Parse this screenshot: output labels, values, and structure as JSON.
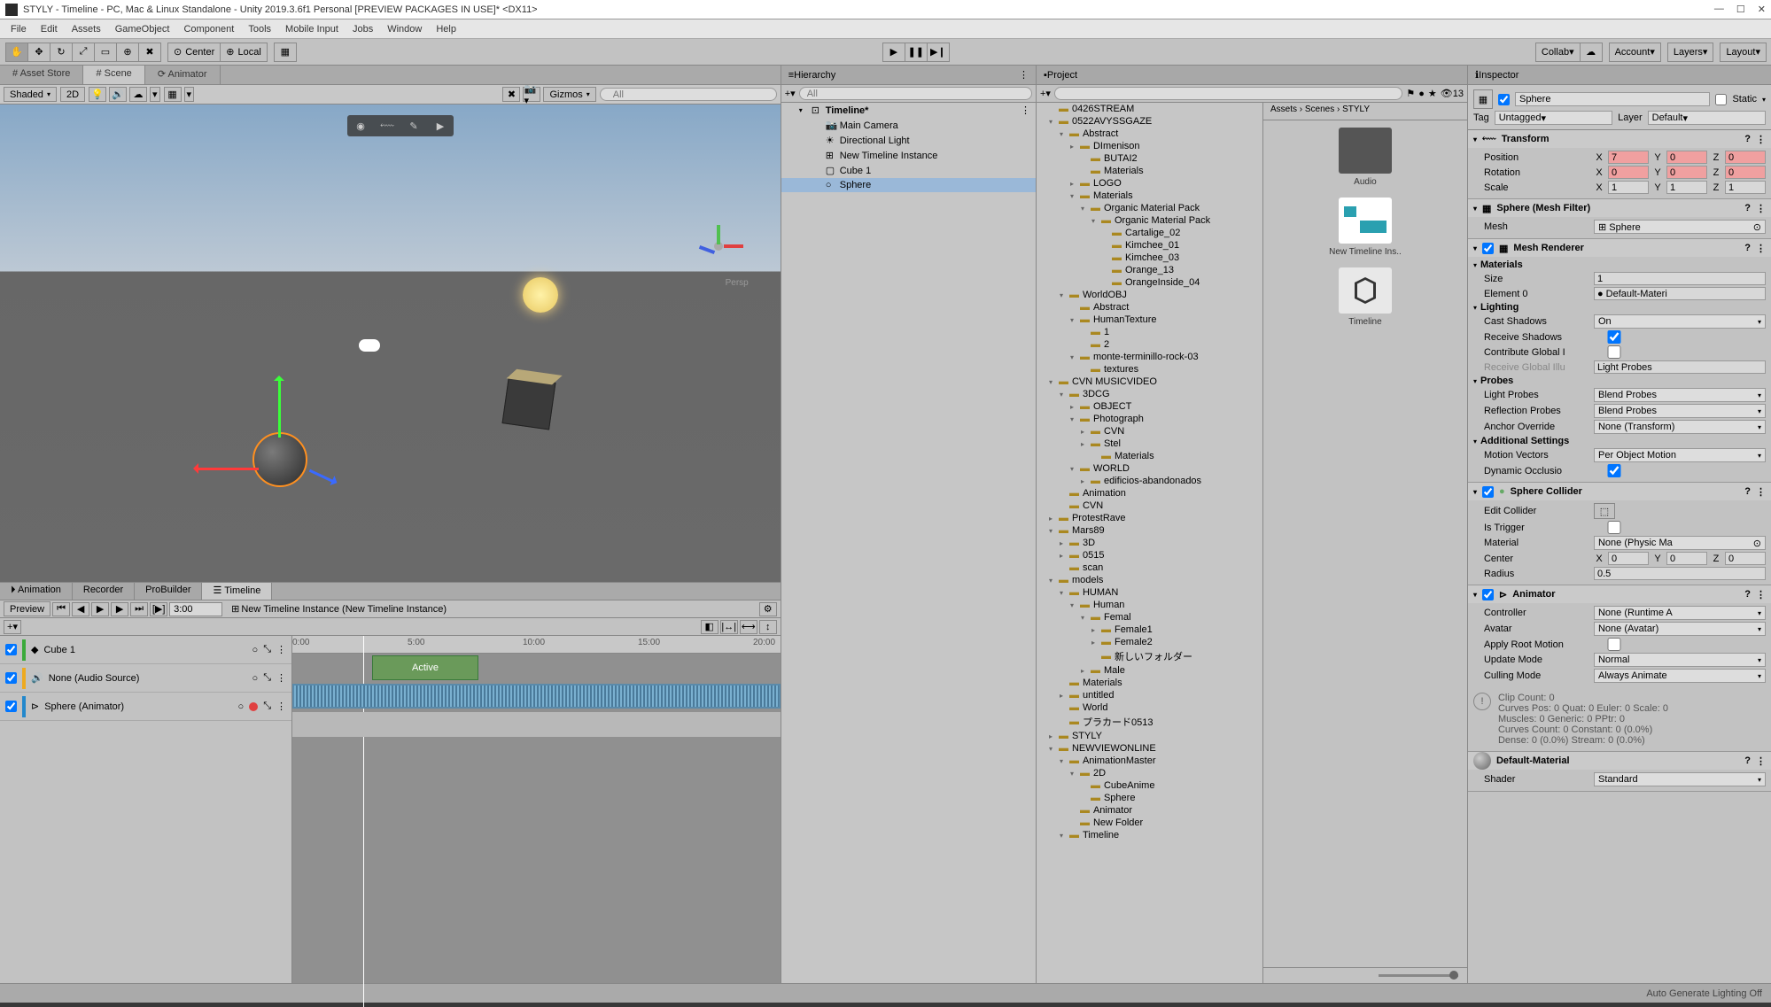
{
  "title": "STYLY - Timeline - PC, Mac & Linux Standalone - Unity 2019.3.6f1 Personal [PREVIEW PACKAGES IN USE]* <DX11>",
  "menu": [
    "File",
    "Edit",
    "Assets",
    "GameObject",
    "Component",
    "Tools",
    "Mobile Input",
    "Jobs",
    "Window",
    "Help"
  ],
  "windowControls": [
    "—",
    "☐",
    "✕"
  ],
  "toolbar": {
    "center": "Center",
    "local": "Local",
    "collab": "Collab",
    "account": "Account",
    "layers": "Layers",
    "layout": "Layout"
  },
  "sceneTabs": [
    "# Asset Store",
    "# Scene",
    "⟳ Animator"
  ],
  "sceneTb": {
    "shaded": "Shaded",
    "mode2d": "2D",
    "gizmos": "Gizmos",
    "search": "All"
  },
  "sceneFloat": [
    "◉",
    "⬳",
    "✎",
    "▶"
  ],
  "perspLabel": "Persp",
  "bottomTabs": [
    "⏵ Animation",
    "Recorder",
    "ProBuilder",
    "☰ Timeline"
  ],
  "timeline": {
    "preview": "Preview",
    "time": "3:00",
    "instance": "New Timeline Instance (New Timeline Instance)",
    "ruler": [
      "0:00",
      "5:00",
      "10:00",
      "15:00",
      "20:00"
    ],
    "tracks": [
      {
        "icon": "◆",
        "name": "Cube 1",
        "ring": "○"
      },
      {
        "icon": "🔊",
        "name": "None (Audio Source)",
        "ring": "○"
      },
      {
        "icon": "⊳",
        "name": "Sphere (Animator)",
        "ring": "○"
      }
    ],
    "activeLabel": "Active"
  },
  "hierarchy": {
    "title": "Hierarchy",
    "searchPlaceholder": "All",
    "items": [
      {
        "fold": "▾",
        "icon": "⊡",
        "name": "Timeline*",
        "bold": true
      },
      {
        "pad": 36,
        "icon": "📷",
        "name": "Main Camera"
      },
      {
        "pad": 36,
        "icon": "☀",
        "name": "Directional Light"
      },
      {
        "pad": 36,
        "icon": "⊞",
        "name": "New Timeline Instance"
      },
      {
        "pad": 36,
        "icon": "▢",
        "name": "Cube 1"
      },
      {
        "pad": 36,
        "icon": "○",
        "name": "Sphere",
        "sel": true
      }
    ]
  },
  "project": {
    "title": "Project",
    "breadcrumb": "Assets › Scenes › STYLY",
    "count": "13",
    "tree": [
      {
        "p": 14,
        "f": "",
        "i": "▸",
        "n": "0426STREAM"
      },
      {
        "p": 14,
        "f": "▾",
        "i": "▸",
        "n": "0522AVYSSGAZE"
      },
      {
        "p": 26,
        "f": "▾",
        "i": "▸",
        "n": "Abstract"
      },
      {
        "p": 38,
        "f": "▸",
        "i": "▸",
        "n": "DImenison"
      },
      {
        "p": 50,
        "f": "",
        "i": "▸",
        "n": "BUTAI2"
      },
      {
        "p": 50,
        "f": "",
        "i": "▸",
        "n": "Materials"
      },
      {
        "p": 38,
        "f": "▸",
        "i": "▸",
        "n": "LOGO"
      },
      {
        "p": 38,
        "f": "▾",
        "i": "▸",
        "n": "Materials"
      },
      {
        "p": 50,
        "f": "▾",
        "i": "▸",
        "n": "Organic Material Pack"
      },
      {
        "p": 62,
        "f": "▾",
        "i": "▸",
        "n": "Organic Material Pack"
      },
      {
        "p": 74,
        "f": "",
        "i": "▸",
        "n": "Cartalige_02"
      },
      {
        "p": 74,
        "f": "",
        "i": "▸",
        "n": "Kimchee_01"
      },
      {
        "p": 74,
        "f": "",
        "i": "▸",
        "n": "Kimchee_03"
      },
      {
        "p": 74,
        "f": "",
        "i": "▸",
        "n": "Orange_13"
      },
      {
        "p": 74,
        "f": "",
        "i": "▸",
        "n": "OrangeInside_04"
      },
      {
        "p": 26,
        "f": "▾",
        "i": "▸",
        "n": "WorldOBJ"
      },
      {
        "p": 38,
        "f": "",
        "i": "▸",
        "n": "Abstract"
      },
      {
        "p": 38,
        "f": "▾",
        "i": "▸",
        "n": "HumanTexture"
      },
      {
        "p": 50,
        "f": "",
        "i": "▸",
        "n": "1"
      },
      {
        "p": 50,
        "f": "",
        "i": "▸",
        "n": "2"
      },
      {
        "p": 38,
        "f": "▾",
        "i": "▸",
        "n": "monte-terminillo-rock-03"
      },
      {
        "p": 50,
        "f": "",
        "i": "▸",
        "n": "textures"
      },
      {
        "p": 14,
        "f": "▾",
        "i": "▸",
        "n": "CVN MUSICVIDEO"
      },
      {
        "p": 26,
        "f": "▾",
        "i": "▸",
        "n": "3DCG"
      },
      {
        "p": 38,
        "f": "▸",
        "i": "▸",
        "n": "OBJECT"
      },
      {
        "p": 38,
        "f": "▾",
        "i": "▸",
        "n": "Photograph"
      },
      {
        "p": 50,
        "f": "▸",
        "i": "▸",
        "n": "CVN"
      },
      {
        "p": 50,
        "f": "▸",
        "i": "▸",
        "n": "Stel"
      },
      {
        "p": 62,
        "f": "",
        "i": "▸",
        "n": "Materials"
      },
      {
        "p": 38,
        "f": "▾",
        "i": "▸",
        "n": "WORLD"
      },
      {
        "p": 50,
        "f": "▸",
        "i": "▸",
        "n": "edificios-abandonados"
      },
      {
        "p": 26,
        "f": "",
        "i": "▸",
        "n": "Animation"
      },
      {
        "p": 26,
        "f": "",
        "i": "▸",
        "n": "CVN"
      },
      {
        "p": 14,
        "f": "▸",
        "i": "▸",
        "n": "ProtestRave"
      },
      {
        "p": 14,
        "f": "▾",
        "i": "▸",
        "n": "Mars89"
      },
      {
        "p": 26,
        "f": "▸",
        "i": "▸",
        "n": "3D"
      },
      {
        "p": 26,
        "f": "▸",
        "i": "▸",
        "n": "0515"
      },
      {
        "p": 26,
        "f": "",
        "i": "▸",
        "n": "scan"
      },
      {
        "p": 14,
        "f": "▾",
        "i": "▸",
        "n": "models"
      },
      {
        "p": 26,
        "f": "▾",
        "i": "▸",
        "n": "HUMAN"
      },
      {
        "p": 38,
        "f": "▾",
        "i": "▸",
        "n": "Human"
      },
      {
        "p": 50,
        "f": "▾",
        "i": "▸",
        "n": "Femal"
      },
      {
        "p": 62,
        "f": "▸",
        "i": "▸",
        "n": "Female1"
      },
      {
        "p": 62,
        "f": "▸",
        "i": "▸",
        "n": "Female2"
      },
      {
        "p": 62,
        "f": "",
        "i": "▸",
        "n": "新しいフォルダー"
      },
      {
        "p": 50,
        "f": "▸",
        "i": "▸",
        "n": "Male"
      },
      {
        "p": 26,
        "f": "",
        "i": "▸",
        "n": "Materials"
      },
      {
        "p": 26,
        "f": "▸",
        "i": "▸",
        "n": "untitled"
      },
      {
        "p": 26,
        "f": "",
        "i": "▸",
        "n": "World"
      },
      {
        "p": 26,
        "f": "",
        "i": "▸",
        "n": "プラカード0513"
      },
      {
        "p": 14,
        "f": "▸",
        "i": "▸",
        "n": "STYLY"
      },
      {
        "p": 14,
        "f": "▾",
        "i": "▸",
        "n": "NEWVIEWONLINE"
      },
      {
        "p": 26,
        "f": "▾",
        "i": "▸",
        "n": "AnimationMaster"
      },
      {
        "p": 38,
        "f": "▾",
        "i": "▸",
        "n": "2D"
      },
      {
        "p": 50,
        "f": "",
        "i": "▸",
        "n": "CubeAnime"
      },
      {
        "p": 50,
        "f": "",
        "i": "▸",
        "n": "Sphere"
      },
      {
        "p": 38,
        "f": "",
        "i": "▸",
        "n": "Animator"
      },
      {
        "p": 38,
        "f": "",
        "i": "▸",
        "n": "New Folder"
      },
      {
        "p": 26,
        "f": "▾",
        "i": "▸",
        "n": "Timeline"
      }
    ],
    "grid": [
      {
        "type": "folder",
        "label": "Audio"
      },
      {
        "type": "tl",
        "label": "New Timeline Ins.."
      },
      {
        "type": "unity",
        "label": "Timeline"
      }
    ]
  },
  "inspector": {
    "title": "Inspector",
    "objName": "Sphere",
    "static": "Static",
    "tag": "Untagged",
    "tagLabel": "Tag",
    "layerLabel": "Layer",
    "layer": "Default",
    "transform": {
      "title": "Transform",
      "rows": [
        {
          "lbl": "Position",
          "x": "7",
          "y": "0",
          "z": "0",
          "red": true
        },
        {
          "lbl": "Rotation",
          "x": "0",
          "y": "0",
          "z": "0",
          "red": true
        },
        {
          "lbl": "Scale",
          "x": "1",
          "y": "1",
          "z": "1"
        }
      ]
    },
    "meshFilter": {
      "title": "Sphere (Mesh Filter)",
      "mesh": "Mesh",
      "meshVal": "⊞ Sphere"
    },
    "meshRenderer": {
      "title": "Mesh Renderer",
      "sections": [
        {
          "h": "Materials",
          "rows": [
            {
              "l": "Size",
              "v": "1"
            },
            {
              "l": "Element 0",
              "v": "● Default-Materi"
            }
          ]
        },
        {
          "h": "Lighting",
          "rows": [
            {
              "l": "Cast Shadows",
              "v": "On",
              "dd": true
            },
            {
              "l": "Receive Shadows",
              "cb": true
            },
            {
              "l": "Contribute Global I",
              "cb": false
            },
            {
              "l": "Receive Global Illu",
              "v": "Light Probes",
              "dim": true
            }
          ]
        },
        {
          "h": "Probes",
          "rows": [
            {
              "l": "Light Probes",
              "v": "Blend Probes",
              "dd": true
            },
            {
              "l": "Reflection Probes",
              "v": "Blend Probes",
              "dd": true
            },
            {
              "l": "Anchor Override",
              "v": "None (Transform)",
              "dd": true
            }
          ]
        },
        {
          "h": "Additional Settings",
          "rows": [
            {
              "l": "Motion Vectors",
              "v": "Per Object Motion",
              "dd": true
            },
            {
              "l": "Dynamic Occlusio",
              "cb": true
            }
          ]
        }
      ]
    },
    "collider": {
      "title": "Sphere Collider",
      "rows": [
        {
          "l": "Edit Collider",
          "btn": true
        },
        {
          "l": "Is Trigger",
          "cb": false
        },
        {
          "l": "Material",
          "v": "None (Physic Ma",
          "dd": true
        },
        {
          "l": "Center",
          "xyz": [
            "0",
            "0",
            "0"
          ]
        },
        {
          "l": "Radius",
          "v": "0.5"
        }
      ]
    },
    "animator": {
      "title": "Animator",
      "rows": [
        {
          "l": "Controller",
          "v": "None (Runtime A",
          "dd": true
        },
        {
          "l": "Avatar",
          "v": "None (Avatar)",
          "dd": true
        },
        {
          "l": "Apply Root Motion",
          "cb": false
        },
        {
          "l": "Update Mode",
          "v": "Normal",
          "dd": true
        },
        {
          "l": "Culling Mode",
          "v": "Always Animate",
          "dd": true
        }
      ],
      "info": "Clip Count: 0\nCurves Pos: 0 Quat: 0 Euler: 0 Scale: 0\nMuscles: 0 Generic: 0 PPtr: 0\nCurves Count: 0 Constant: 0 (0.0%)\nDense: 0 (0.0%) Stream: 0 (0.0%)"
    },
    "material": {
      "name": "Default-Material",
      "shader": "Shader",
      "shaderVal": "Standard"
    }
  },
  "status": "Auto Generate Lighting Off"
}
